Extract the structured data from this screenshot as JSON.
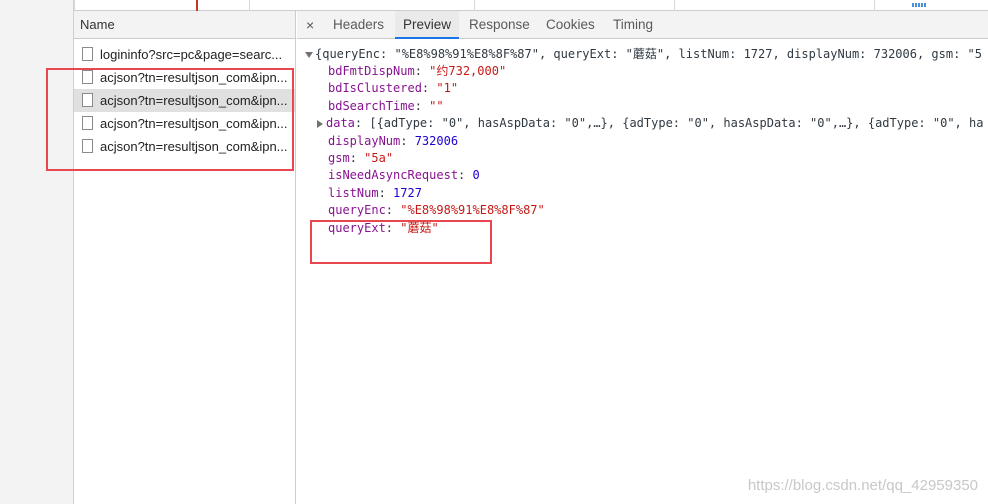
{
  "name_panel": {
    "header": "Name",
    "requests": [
      {
        "name": "logininfo?src=pc&page=searc..."
      },
      {
        "name": "acjson?tn=resultjson_com&ipn..."
      },
      {
        "name": "acjson?tn=resultjson_com&ipn..."
      },
      {
        "name": "acjson?tn=resultjson_com&ipn..."
      },
      {
        "name": "acjson?tn=resultjson_com&ipn..."
      }
    ],
    "selected_index": 2
  },
  "tabs": {
    "close": "×",
    "items": [
      "Headers",
      "Preview",
      "Response",
      "Cookies",
      "Timing"
    ],
    "active": "Preview"
  },
  "preview": {
    "summary": "{queryEnc: \"%E8%98%91%E8%8F%87\", queryExt: \"蘑菇\", listNum: 1727, displayNum: 732006, gsm: \"5",
    "props": [
      {
        "key": "bdFmtDispNum",
        "value": "\"约732,000\"",
        "type": "string"
      },
      {
        "key": "bdIsClustered",
        "value": "\"1\"",
        "type": "string"
      },
      {
        "key": "bdSearchTime",
        "value": "\"\"",
        "type": "string"
      },
      {
        "key": "data",
        "value": "[{adType: \"0\", hasAspData: \"0\",…}, {adType: \"0\", hasAspData: \"0\",…}, {adType: \"0\", ha",
        "type": "array"
      },
      {
        "key": "displayNum",
        "value": "732006",
        "type": "number"
      },
      {
        "key": "gsm",
        "value": "\"5a\"",
        "type": "string"
      },
      {
        "key": "isNeedAsyncRequest",
        "value": "0",
        "type": "number"
      },
      {
        "key": "listNum",
        "value": "1727",
        "type": "number"
      },
      {
        "key": "queryEnc",
        "value": "\"%E8%98%91%E8%8F%87\"",
        "type": "string"
      },
      {
        "key": "queryExt",
        "value": "\"蘑菇\"",
        "type": "string"
      }
    ]
  },
  "watermark": "https://blog.csdn.net/qq_42959350",
  "colors": {
    "annotation": "#e8474f",
    "key": "#881391",
    "string": "#c41a16",
    "number": "#1c00cf",
    "tab_active_underline": "#1a73e8"
  }
}
